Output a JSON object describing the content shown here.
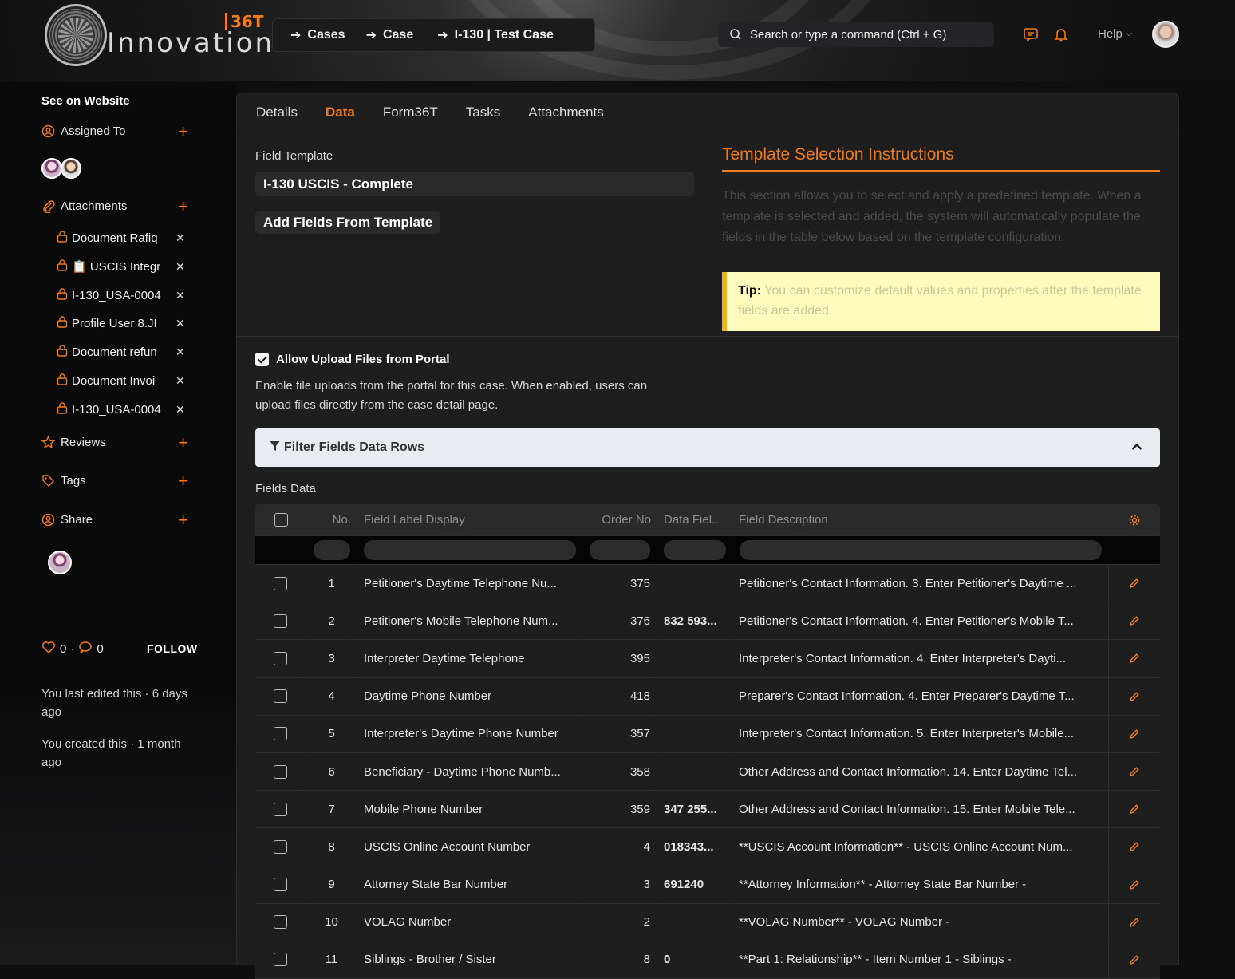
{
  "brand": {
    "name": "Innovation",
    "mark": "36T"
  },
  "breadcrumb": [
    "Cases",
    "Case",
    "I-130 | Test Case"
  ],
  "search": {
    "placeholder": "Search or type a command (Ctrl + G)"
  },
  "header": {
    "help_label": "Help"
  },
  "sidebar": {
    "see_website": "See on Website",
    "assigned_to": "Assigned To",
    "attachments_label": "Attachments",
    "attachments": [
      "Document Rafiq",
      "📋 USCIS Integr",
      "I-130_USA-0004",
      "Profile User 8.JI",
      "Document refun",
      "Document Invoi",
      "I-130_USA-0004"
    ],
    "reviews": "Reviews",
    "tags": "Tags",
    "share": "Share",
    "likes": "0",
    "comments": "0",
    "count_separator": "·",
    "follow": "FOLLOW",
    "last_edited": "You last edited this · 6 days ago",
    "created": "You created this · 1 month ago"
  },
  "tabs": [
    "Details",
    "Data",
    "Form36T",
    "Tasks",
    "Attachments"
  ],
  "active_tab": "Data",
  "template": {
    "field_label": "Field Template",
    "value": "I-130 USCIS - Complete",
    "add_button": "Add Fields From Template",
    "instructions_title": "Template Selection Instructions",
    "instructions_body": "This section allows you to select and apply a predefined template. When a template is selected and added, the system will automatically populate the fields in the table below based on the template configuration.",
    "tip_label": "Tip:",
    "tip_text": "You can customize default values and properties after the template fields are added."
  },
  "portal": {
    "checkbox_label": "Allow Upload Files from Portal",
    "checked": true,
    "description": "Enable file uploads from the portal for this case. When enabled, users can upload files directly from the case detail page."
  },
  "filter": {
    "label": "Filter Fields Data Rows"
  },
  "fields_data_label": "Fields Data",
  "table": {
    "columns": [
      "No.",
      "Field Label Display",
      "Order No",
      "Data Fiel...",
      "Field Description"
    ],
    "rows": [
      [
        "1",
        "Petitioner's Daytime Telephone Nu...",
        "375",
        "",
        "Petitioner's Contact Information. 3. Enter Petitioner's Daytime ..."
      ],
      [
        "2",
        "Petitioner's Mobile Telephone Num...",
        "376",
        "832 593...",
        "Petitioner's Contact Information. 4. Enter Petitioner's Mobile T..."
      ],
      [
        "3",
        "Interpreter Daytime Telephone",
        "395",
        "",
        "Interpreter's Contact Information. 4. Enter Interpreter's Dayti..."
      ],
      [
        "4",
        "Daytime Phone Number",
        "418",
        "",
        "Preparer's Contact Information. 4. Enter Preparer's Daytime T..."
      ],
      [
        "5",
        "Interpreter's Daytime Phone Number",
        "357",
        "",
        "Interpreter's Contact Information. 5. Enter Interpreter's Mobile..."
      ],
      [
        "6",
        "Beneficiary - Daytime Phone Numb...",
        "358",
        "",
        "Other Address and Contact Information. 14. Enter Daytime Tel..."
      ],
      [
        "7",
        "Mobile Phone Number",
        "359",
        "347 255...",
        "Other Address and Contact Information. 15. Enter Mobile Tele..."
      ],
      [
        "8",
        "USCIS Online Account Number",
        "4",
        "018343...",
        "**USCIS Account Information** - USCIS Online Account Num..."
      ],
      [
        "9",
        "Attorney State Bar Number",
        "3",
        "691240",
        "**Attorney Information** - Attorney State Bar Number -"
      ],
      [
        "10",
        "VOLAG Number",
        "2",
        "",
        "**VOLAG Number** - VOLAG Number -"
      ],
      [
        "11",
        "Siblings - Brother / Sister",
        "8",
        "0",
        "**Part 1: Relationship** - Item Number 1 - Siblings -"
      ]
    ]
  },
  "colors": {
    "accent": "#f27a1a",
    "tip_bg": "#fffbbd"
  }
}
